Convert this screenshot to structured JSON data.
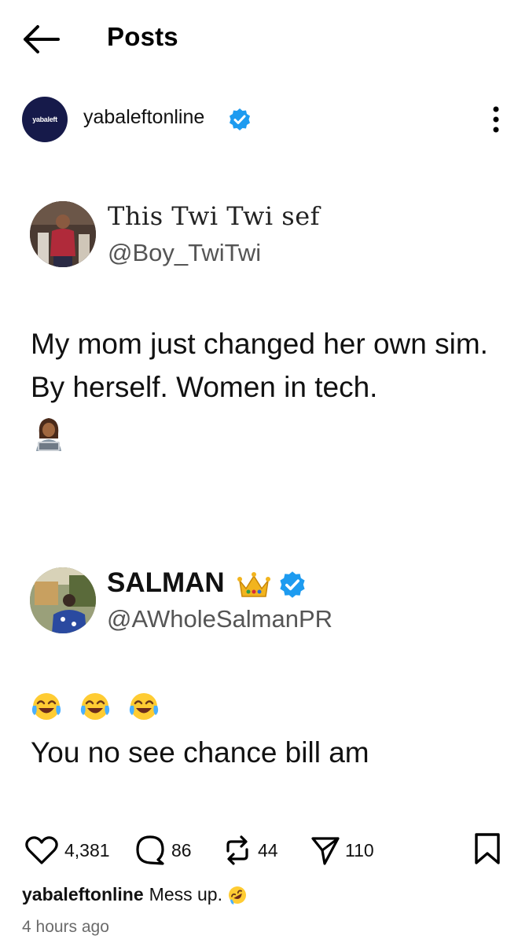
{
  "header": {
    "title": "Posts",
    "back_icon": "arrow-left-icon"
  },
  "post": {
    "author": {
      "username": "yabaleftonline",
      "avatar_text": "yabaleft",
      "verified": true,
      "avatar_color": "#161a4a"
    },
    "more_icon": "more-vertical-icon",
    "embedded_tweets": [
      {
        "display_name": "This Twi Twi sef",
        "handle": "@Boy_TwiTwi",
        "text": "My mom just changed her own sim.  By herself. Women in tech.",
        "emoji": "woman-technologist-emoji"
      },
      {
        "display_name": "SALMAN",
        "name_emoji": "crown-emoji",
        "verified": true,
        "handle": "@AWholeSalmanPR",
        "emojis": [
          "face-with-tears-of-joy-emoji",
          "face-with-tears-of-joy-emoji",
          "face-with-tears-of-joy-emoji"
        ],
        "text": "You no see chance bill am"
      }
    ],
    "actions": {
      "likes": "4,381",
      "comments": "86",
      "reposts": "44",
      "shares": "110"
    },
    "caption": {
      "username": "yabaleftonline",
      "text": "Mess up.",
      "emoji": "rolling-on-floor-laughing-emoji"
    },
    "timestamp": "4 hours ago"
  },
  "colors": {
    "verified_blue": "#1d9bf0",
    "text": "#111111",
    "secondary_text": "#6b6b6b"
  }
}
